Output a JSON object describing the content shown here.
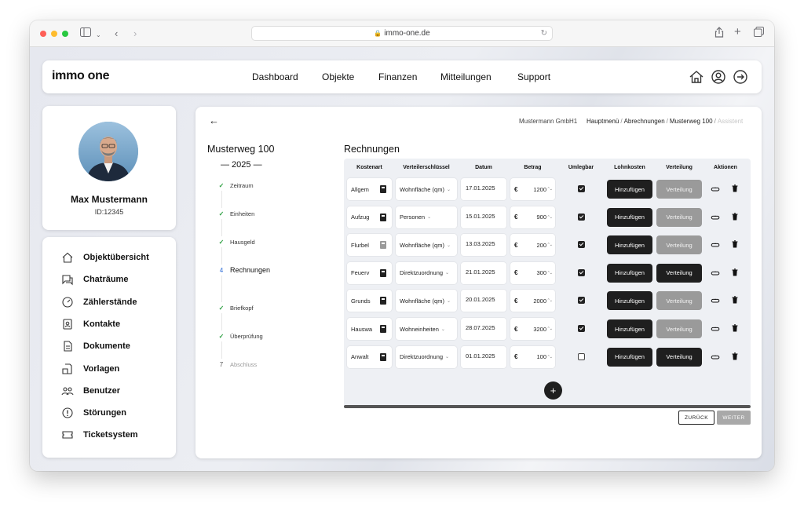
{
  "browser": {
    "url": "immo-one.de"
  },
  "nav": {
    "logo": "immo one",
    "items": [
      "Dashboard",
      "Objekte",
      "Finanzen",
      "Mitteilungen",
      "Support"
    ]
  },
  "profile": {
    "name": "Max Mustermann",
    "id": "ID:12345"
  },
  "sidebar": {
    "items": [
      {
        "label": "Objektübersicht",
        "icon": "home-icon"
      },
      {
        "label": "Chaträume",
        "icon": "chat-icon"
      },
      {
        "label": "Zählerstände",
        "icon": "gauge-icon"
      },
      {
        "label": "Kontakte",
        "icon": "contact-icon"
      },
      {
        "label": "Dokumente",
        "icon": "document-icon"
      },
      {
        "label": "Vorlagen",
        "icon": "template-icon"
      },
      {
        "label": "Benutzer",
        "icon": "users-icon"
      },
      {
        "label": "Störungen",
        "icon": "alert-icon"
      },
      {
        "label": "Ticketsystem",
        "icon": "ticket-icon"
      }
    ]
  },
  "header": {
    "company": "Mustermann GmbH1",
    "breadcrumb": [
      "Hauptmenü",
      "Abrechnungen",
      "Musterweg 100",
      "Assistent"
    ]
  },
  "wizard": {
    "object": "Musterweg 100",
    "year": "— 2025 —",
    "steps": [
      {
        "label": "Zeitraum",
        "state": "done"
      },
      {
        "label": "Einheiten",
        "state": "done"
      },
      {
        "label": "Hausgeld",
        "state": "done"
      },
      {
        "label": "Rechnungen",
        "state": "active",
        "num": "4"
      },
      {
        "label": "Briefkopf",
        "state": "done"
      },
      {
        "label": "Überprüfung",
        "state": "done"
      },
      {
        "label": "Abschluss",
        "state": "pending",
        "num": "7"
      }
    ]
  },
  "invoices": {
    "title": "Rechnungen",
    "columns": [
      "Kostenart",
      "Verteilerschlüssel",
      "Datum",
      "Betrag",
      "Umlegbar",
      "Lohnkosten",
      "Verteilung",
      "Aktionen"
    ],
    "currency": "€",
    "hinzufuegen_label": "Hinzufügen",
    "verteilung_label": "Verteilung",
    "rows": [
      {
        "kostenart": "Allgem",
        "schluessel": "Wohnfläche (qm)",
        "datum": "17.01.2025",
        "betrag": "1200",
        "umlegbar": true,
        "verteilung_active": false,
        "calc_dark": true
      },
      {
        "kostenart": "Aufzug",
        "schluessel": "Personen",
        "datum": "15.01.2025",
        "betrag": "900",
        "umlegbar": true,
        "verteilung_active": false,
        "calc_dark": true
      },
      {
        "kostenart": "Flurbel",
        "schluessel": "Wohnfläche (qm)",
        "datum": "13.03.2025",
        "betrag": "200",
        "umlegbar": true,
        "verteilung_active": false,
        "calc_dark": false
      },
      {
        "kostenart": "Feuerv",
        "schluessel": "Direktzuordnung",
        "datum": "21.01.2025",
        "betrag": "300",
        "umlegbar": true,
        "verteilung_active": true,
        "calc_dark": true
      },
      {
        "kostenart": "Grunds",
        "schluessel": "Wohnfläche (qm)",
        "datum": "20.01.2025",
        "betrag": "2000",
        "umlegbar": true,
        "verteilung_active": false,
        "calc_dark": true
      },
      {
        "kostenart": "Hauswa",
        "schluessel": "Wohneinheiten",
        "datum": "28.07.2025",
        "betrag": "3200",
        "umlegbar": true,
        "verteilung_active": false,
        "calc_dark": true
      },
      {
        "kostenart": "Anwalt",
        "schluessel": "Direktzuordnung",
        "datum": "01.01.2025",
        "betrag": "100",
        "umlegbar": false,
        "verteilung_active": true,
        "calc_dark": true
      }
    ],
    "add_label": "+"
  },
  "footer": {
    "back": "ZURÜCK",
    "next": "WEITER"
  }
}
